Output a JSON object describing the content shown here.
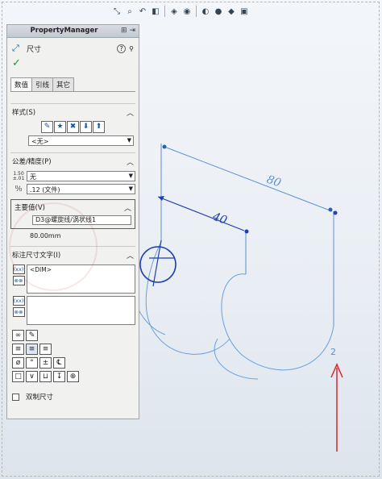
{
  "toolbar": {
    "icons": [
      "zoom-to-fit-icon",
      "zoom-area-icon",
      "previous-view-icon",
      "section-view-icon",
      "view-orientation-icon",
      "display-style-icon",
      "hide-show-icon",
      "edit-appearance-icon",
      "apply-scene-icon",
      "view-settings-icon"
    ]
  },
  "panel": {
    "header": "PropertyManager",
    "feature_name": "尺寸",
    "tabs": [
      "数值",
      "引线",
      "其它"
    ],
    "style": {
      "title": "样式(S)",
      "dropdown": "<无>"
    },
    "tolerance": {
      "title": "公差/精度(P)",
      "type": "无",
      "precision": ".12 (文件)",
      "icon_text": "1.50 ±.01"
    },
    "primary": {
      "title": "主要值(V)",
      "name": "D3@螺旋线/涡状线1",
      "value": "80.00mm"
    },
    "dimtext": {
      "title": "标注尺寸文字(I)",
      "text": "<DIM>"
    },
    "dual": "双制尺寸"
  },
  "sketch": {
    "dim_80": "80",
    "dim_40": "40",
    "marker_2": "2"
  }
}
